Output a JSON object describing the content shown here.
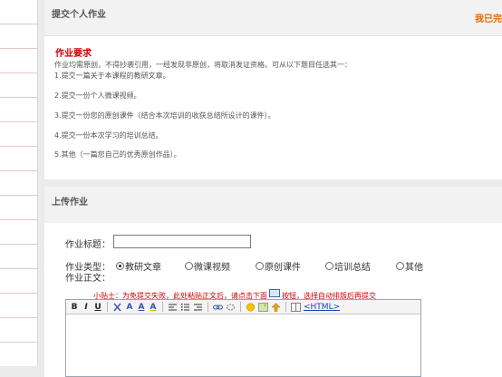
{
  "panel_assignment": {
    "title": "提交个人作业",
    "right_text": "我已完",
    "requirement_title": "作业要求",
    "requirement_lines": [
      "作业均需原创，不得抄袭引用，一经发现非原创，将取消发证资格。可从以下题目任选其一：",
      "1.提交一篇关于本课程的教研文章。",
      "2.提交一份个人微课视频。",
      "3.提交一份您的原创课件（结合本次培训的收获总结所设计的课件）。",
      "4.提交一份本次学习的培训总结。",
      "5.其他（一篇您自己的优秀原创作品）。"
    ]
  },
  "panel_upload": {
    "title": "上传作业",
    "title_label": "作业标题：",
    "title_value": "",
    "type_label": "作业类型：",
    "content_label": "作业正文：",
    "types": [
      {
        "label": "教研文章",
        "checked": true
      },
      {
        "label": "微课视频",
        "checked": false
      },
      {
        "label": "原创课件",
        "checked": false
      },
      {
        "label": "培训总结",
        "checked": false
      },
      {
        "label": "其他",
        "checked": false
      }
    ],
    "tip_prefix": "小贴士：为免提交失败，此处粘贴正文后，请点击下面",
    "tip_suffix": "按钮，选择自动排版后再提交",
    "toolbar": {
      "bold": "B",
      "italic": "I",
      "underline": "U",
      "html": "<HTML>"
    }
  }
}
